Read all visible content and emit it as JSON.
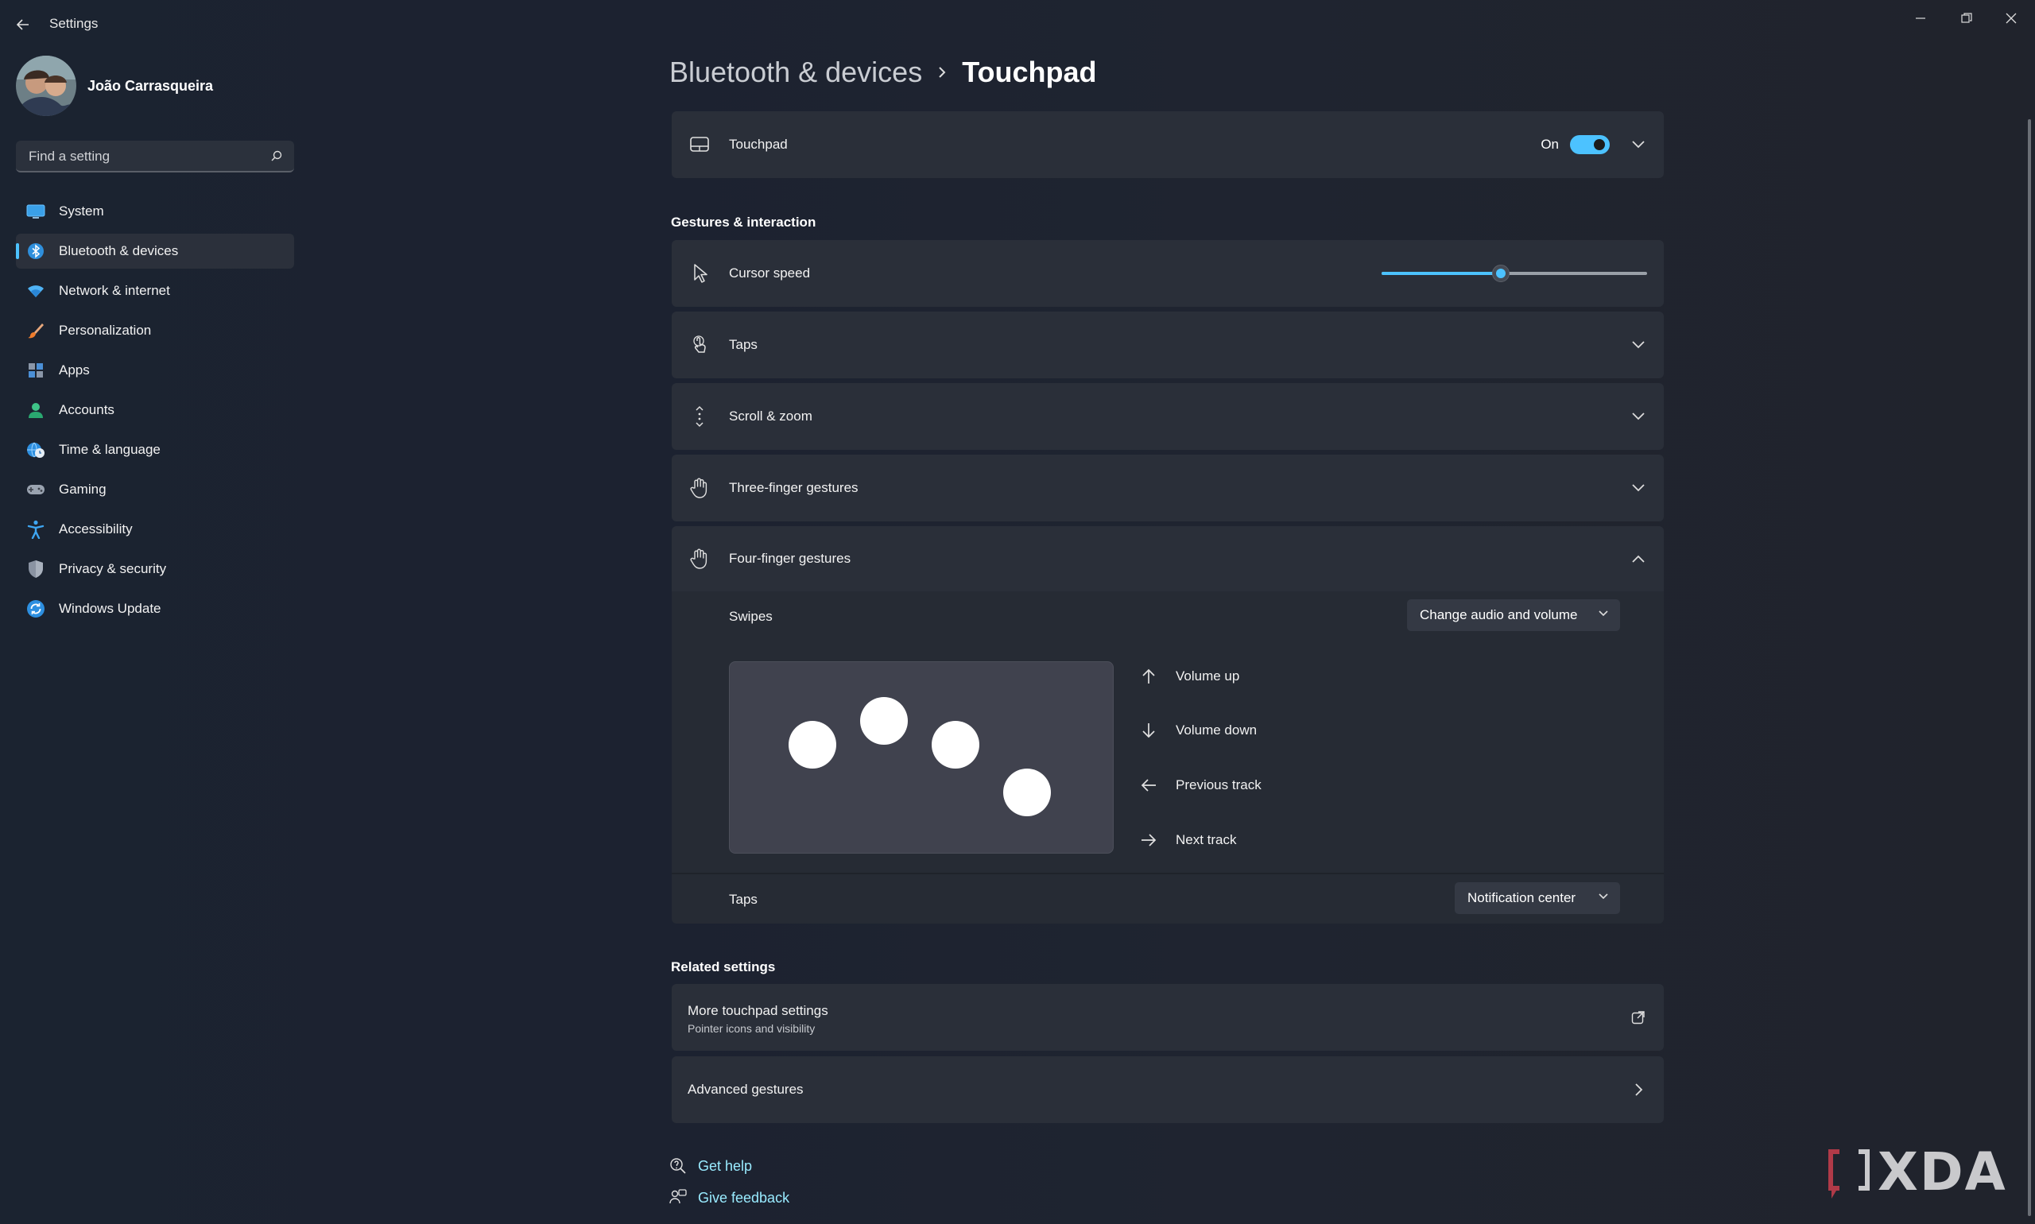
{
  "window": {
    "title": "Settings"
  },
  "user": {
    "name": "João Carrasqueira"
  },
  "search": {
    "placeholder": "Find a setting"
  },
  "sidebar": {
    "items": [
      {
        "label": "System",
        "icon": "monitor-icon"
      },
      {
        "label": "Bluetooth & devices",
        "icon": "bluetooth-icon",
        "active": true
      },
      {
        "label": "Network & internet",
        "icon": "wifi-icon"
      },
      {
        "label": "Personalization",
        "icon": "brush-icon"
      },
      {
        "label": "Apps",
        "icon": "apps-icon"
      },
      {
        "label": "Accounts",
        "icon": "person-icon"
      },
      {
        "label": "Time & language",
        "icon": "globe-clock-icon"
      },
      {
        "label": "Gaming",
        "icon": "gamepad-icon"
      },
      {
        "label": "Accessibility",
        "icon": "accessibility-icon"
      },
      {
        "label": "Privacy & security",
        "icon": "shield-icon"
      },
      {
        "label": "Windows Update",
        "icon": "update-icon"
      }
    ]
  },
  "breadcrumb": {
    "parent": "Bluetooth & devices",
    "current": "Touchpad"
  },
  "touchpad": {
    "label": "Touchpad",
    "state_text": "On",
    "enabled": true
  },
  "gestures": {
    "section_title": "Gestures & interaction",
    "cursor_speed": {
      "label": "Cursor speed",
      "value_fraction": 0.45
    },
    "taps": {
      "label": "Taps"
    },
    "scroll_zoom": {
      "label": "Scroll & zoom"
    },
    "three_finger": {
      "label": "Three-finger gestures"
    },
    "four_finger": {
      "label": "Four-finger gestures",
      "swipes_label": "Swipes",
      "swipes_value": "Change audio and volume",
      "actions": {
        "up": "Volume up",
        "down": "Volume down",
        "left": "Previous track",
        "right": "Next track"
      },
      "taps_label": "Taps",
      "taps_value": "Notification center"
    }
  },
  "related": {
    "section_title": "Related settings",
    "more_touchpad": {
      "title": "More touchpad settings",
      "subtitle": "Pointer icons and visibility"
    },
    "advanced": {
      "title": "Advanced gestures"
    }
  },
  "help": {
    "get_help": "Get help",
    "give_feedback": "Give feedback"
  },
  "colors": {
    "accent": "#4cc2ff",
    "background": "#1c2230",
    "card": "#2a2f39"
  }
}
